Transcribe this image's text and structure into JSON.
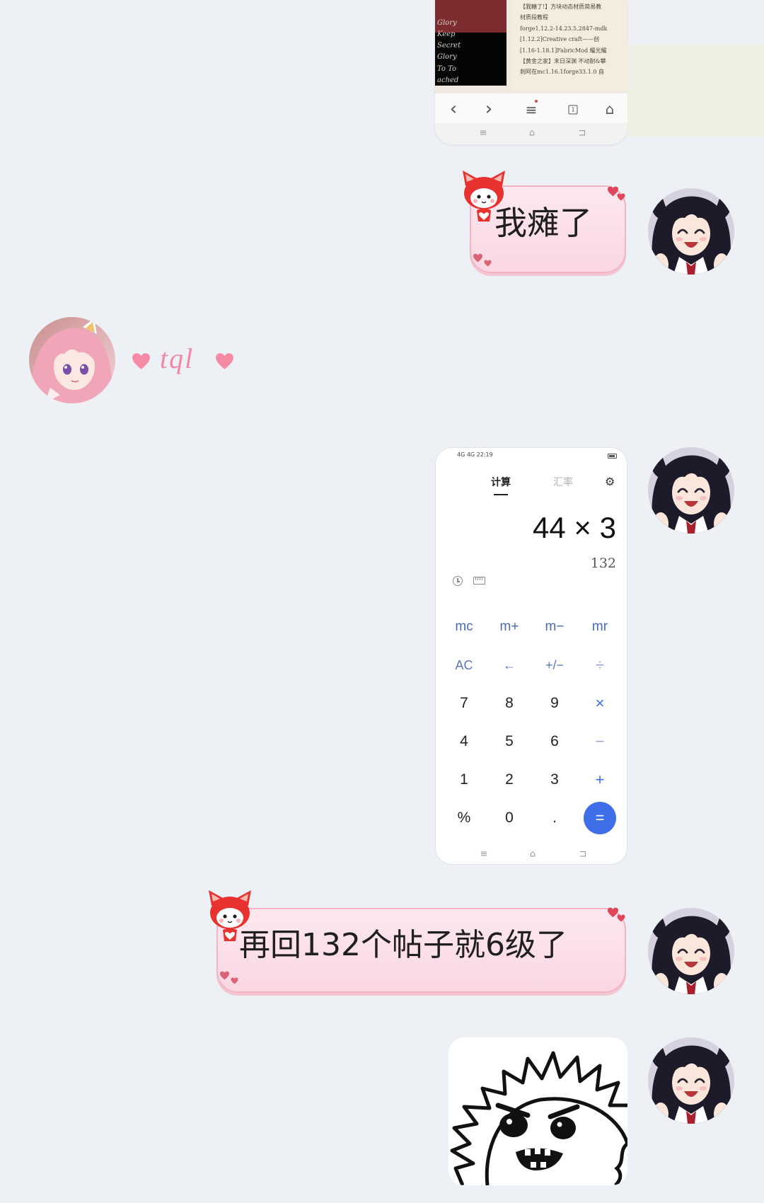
{
  "theme": {
    "page_background": "#edf0f4",
    "bubble_fill": "#fbdde7",
    "bubble_border": "#f2b3c3",
    "heart_pink": "#f48aa3",
    "calc_accent": "#3e6ee8"
  },
  "top_image": {
    "poster_lines": [
      "Glory",
      "Keep",
      "Secret",
      "Glory",
      "To To",
      "ached"
    ],
    "list_lines": [
      "【我糖了!】方块动态材质简易教",
      "材质段教程",
      "forge1.12.2-14.23.5.2847-mdk",
      "[1.12.2]Creative craft——创",
      "[1.16-1.18.1]FabricMod 耀光耀",
      "【黄金之家】末日深渊 不动耐&攀",
      "刺阿在mc1.16.1forge33.1.0 自"
    ],
    "browser_nav": [
      {
        "icon": "chevron-left-icon",
        "glyph": "‹"
      },
      {
        "icon": "chevron-right-icon",
        "glyph": "›"
      },
      {
        "icon": "menu-icon",
        "glyph": "≡"
      },
      {
        "icon": "tabs-icon",
        "glyph": "1"
      },
      {
        "icon": "home-icon",
        "glyph": "⌂"
      }
    ],
    "system_nav": [
      {
        "icon": "menu-icon",
        "glyph": "≡"
      },
      {
        "icon": "home-icon",
        "glyph": "⌂"
      },
      {
        "icon": "back-icon",
        "glyph": "⊐"
      }
    ]
  },
  "chat": {
    "msg_1": {
      "text": "我瘫了"
    },
    "msg_2": {
      "text": "tql"
    },
    "msg_4": {
      "text": "再回132个帖子就6级了"
    }
  },
  "calculator": {
    "status_bar": "4G 4G 22:19",
    "tabs": [
      {
        "label": "计算",
        "active": true
      },
      {
        "label": "汇率",
        "active": false
      }
    ],
    "settings_glyph": "⚙",
    "expression": "44 × 3",
    "result": "132",
    "tool_icons": [
      "history-icon",
      "ruler-icon"
    ],
    "keys": [
      [
        "mc",
        "m+",
        "m−",
        "mr"
      ],
      [
        "AC",
        "←",
        "+/−",
        "÷"
      ],
      [
        "7",
        "8",
        "9",
        "×"
      ],
      [
        "4",
        "5",
        "6",
        "−"
      ],
      [
        "1",
        "2",
        "3",
        "+"
      ],
      [
        "%",
        "0",
        ".",
        "="
      ]
    ],
    "system_nav": [
      {
        "icon": "menu-icon",
        "glyph": "≡"
      },
      {
        "icon": "home-icon",
        "glyph": "⌂"
      },
      {
        "icon": "back-icon",
        "glyph": "⊐"
      }
    ]
  }
}
